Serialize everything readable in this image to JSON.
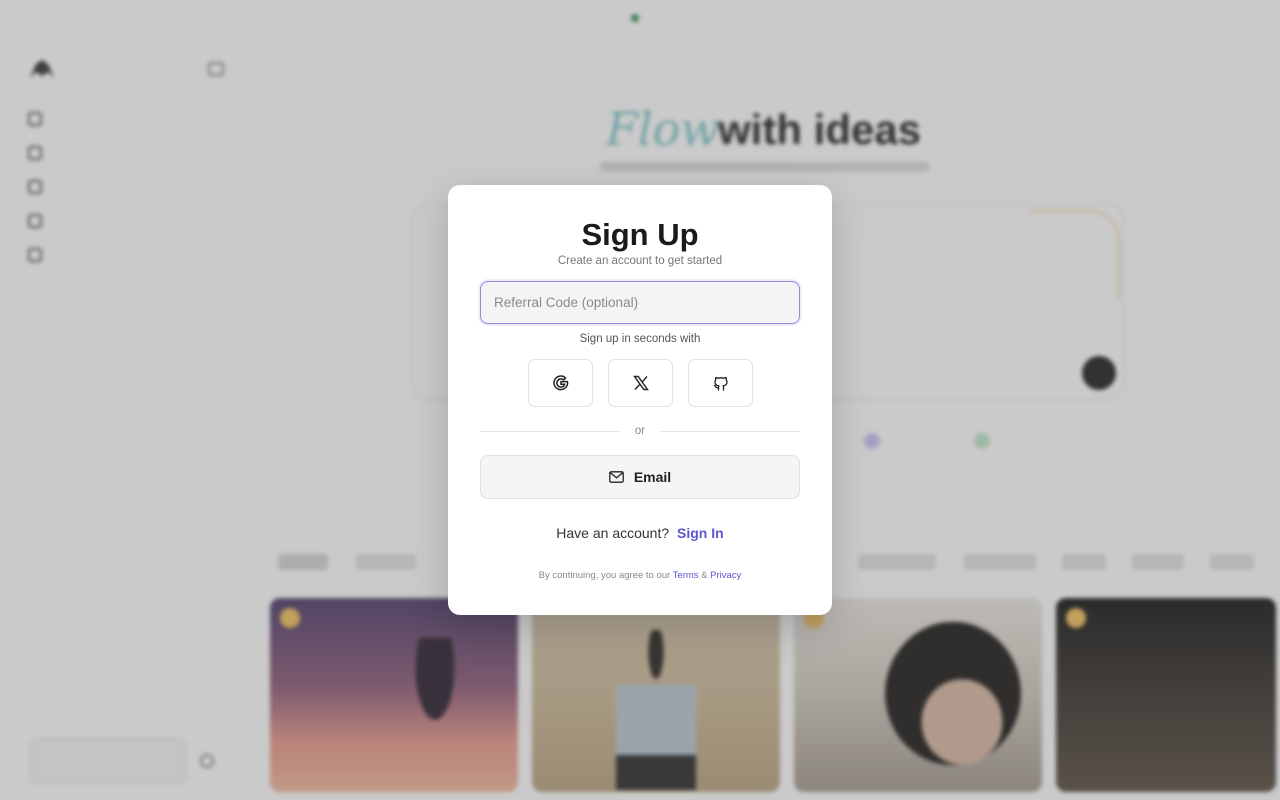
{
  "background": {
    "announcement": "",
    "hero": {
      "script_word": "Flow",
      "title": "with ideas"
    },
    "sidebar": {
      "items": [
        {
          "icon": "plus-icon"
        },
        {
          "icon": "library-icon"
        },
        {
          "icon": "history-icon"
        },
        {
          "icon": "knowledge-icon"
        },
        {
          "icon": "knowledge-market-icon"
        }
      ]
    }
  },
  "modal": {
    "title": "Sign Up",
    "subtitle": "Create an account to get started",
    "referral_placeholder": "Referral Code (optional)",
    "seconds_text": "Sign up in seconds with",
    "social": [
      {
        "name": "google",
        "icon": "google-icon"
      },
      {
        "name": "x",
        "icon": "x-icon"
      },
      {
        "name": "github",
        "icon": "github-icon"
      }
    ],
    "or_text": "or",
    "email_label": "Email",
    "have_account_text": "Have an account?",
    "sign_in_label": "Sign In",
    "legal_prefix": "By continuing, you agree to our",
    "terms_label": "Terms",
    "amp": "&",
    "privacy_label": "Privacy"
  },
  "colors": {
    "accent": "#5b57d1",
    "input_focus_border": "#8d8ae0",
    "overlay": "rgba(90,90,90,0.32)"
  }
}
